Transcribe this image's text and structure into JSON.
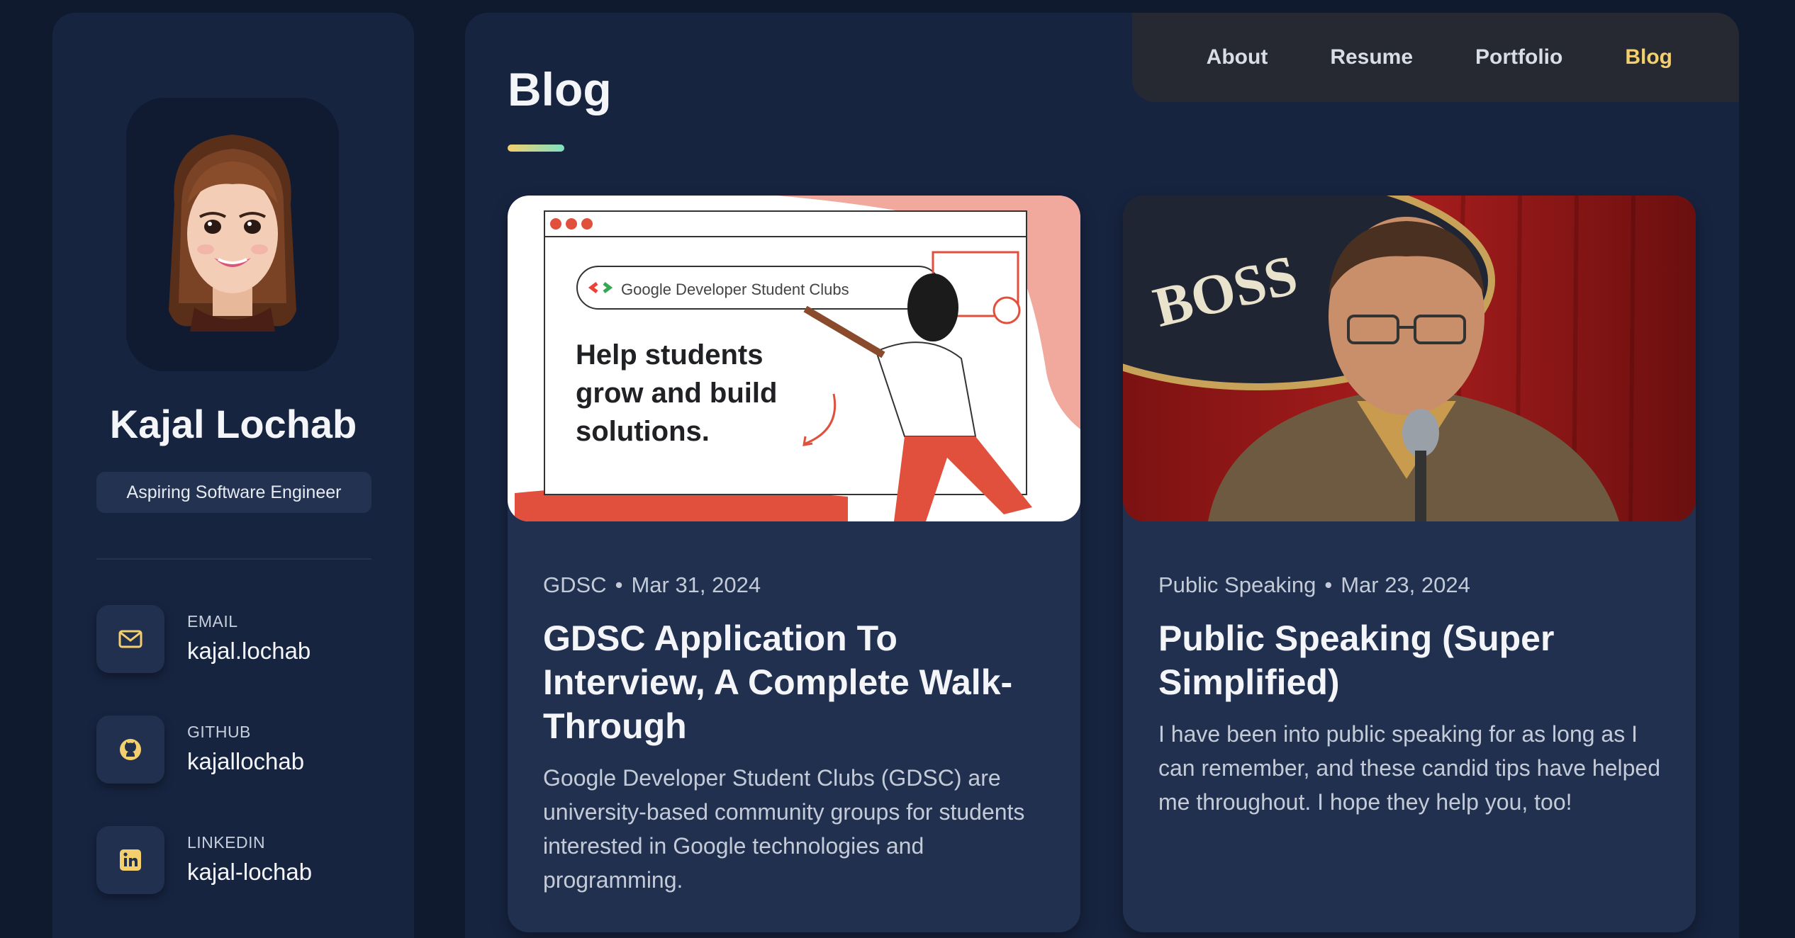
{
  "profile": {
    "name": "Kajal Lochab",
    "title": "Aspiring Software Engineer"
  },
  "contacts": [
    {
      "label": "EMAIL",
      "value": "kajal.lochab",
      "icon": "mail-icon"
    },
    {
      "label": "GITHUB",
      "value": "kajallochab",
      "icon": "github-icon"
    },
    {
      "label": "LINKEDIN",
      "value": "kajal-lochab",
      "icon": "linkedin-icon"
    }
  ],
  "nav": {
    "items": [
      {
        "label": "About"
      },
      {
        "label": "Resume"
      },
      {
        "label": "Portfolio"
      },
      {
        "label": "Blog"
      }
    ],
    "active": "Blog"
  },
  "page": {
    "heading": "Blog"
  },
  "posts": [
    {
      "category": "GDSC",
      "date": "Mar 31, 2024",
      "title": "GDSC Application To Interview, A Complete Walk-Through",
      "excerpt": "Google Developer Student Clubs (GDSC) are university-based community groups for students interested in Google technologies and programming.",
      "image": {
        "banner": "Google Developer Student Clubs",
        "headline_lines": [
          "Help students",
          "grow and build",
          "solutions."
        ]
      }
    },
    {
      "category": "Public Speaking",
      "date": "Mar 23, 2024",
      "title": "Public Speaking (Super Simplified)",
      "excerpt": "I have been into public speaking for as long as I can remember, and these candid tips have helped me throughout. I hope they help you, too!",
      "image": {
        "sign_text": "BOSS"
      }
    }
  ],
  "colors": {
    "background": "#101a2e",
    "panel": "#172440",
    "card": "#22304f",
    "accent": "#f4cf6d",
    "navbar": "#262932"
  }
}
